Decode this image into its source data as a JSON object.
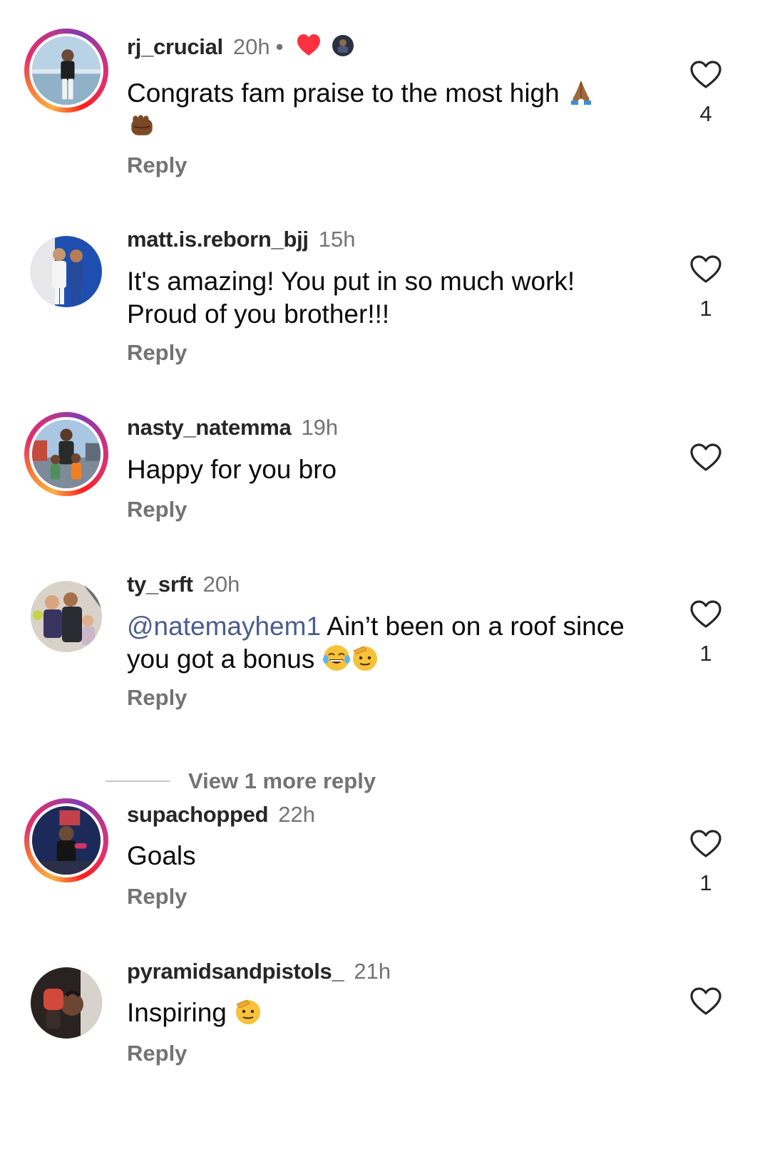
{
  "comments": [
    {
      "username": "rj_crucial",
      "time": "20h",
      "separator": "•",
      "text": "Congrats fam praise to the most high",
      "emojis": [
        "folded-hands",
        "raised-fist"
      ],
      "reply_label": "Reply",
      "like_count": "4",
      "author_liked": true,
      "has_story_ring": true
    },
    {
      "username": "matt.is.reborn_bjj",
      "time": "15h",
      "text_line1": "It's amazing! You put in so much work!",
      "text_line2": "Proud of you brother!!!",
      "reply_label": "Reply",
      "like_count": "1",
      "has_story_ring": false
    },
    {
      "username": "nasty_natemma",
      "time": "19h",
      "text": "Happy for you bro",
      "reply_label": "Reply",
      "like_count": "",
      "has_story_ring": true
    },
    {
      "username": "ty_srft",
      "time": "20h",
      "mention": "@natemayhem1",
      "text_line1": " Ain’t been on a roof since",
      "text_line2": "you got a bonus",
      "emojis": [
        "face-with-tears-of-joy",
        "saluting-face"
      ],
      "reply_label": "Reply",
      "like_count": "1",
      "has_story_ring": false,
      "view_more_label": "View 1 more reply"
    },
    {
      "username": "supachopped",
      "time": "22h",
      "text": "Goals",
      "reply_label": "Reply",
      "like_count": "1",
      "has_story_ring": true
    },
    {
      "username": "pyramidsandpistols_",
      "time": "21h",
      "text": "Inspiring",
      "emojis": [
        "saluting-face"
      ],
      "reply_label": "Reply",
      "like_count": "",
      "has_story_ring": false
    }
  ],
  "icons": {
    "like": "heart-outline-icon",
    "author_like": "heart-filled-icon"
  },
  "colors": {
    "author_heart": "#ff3040",
    "mention": "#4a5d8c",
    "secondary_text": "#737373"
  }
}
